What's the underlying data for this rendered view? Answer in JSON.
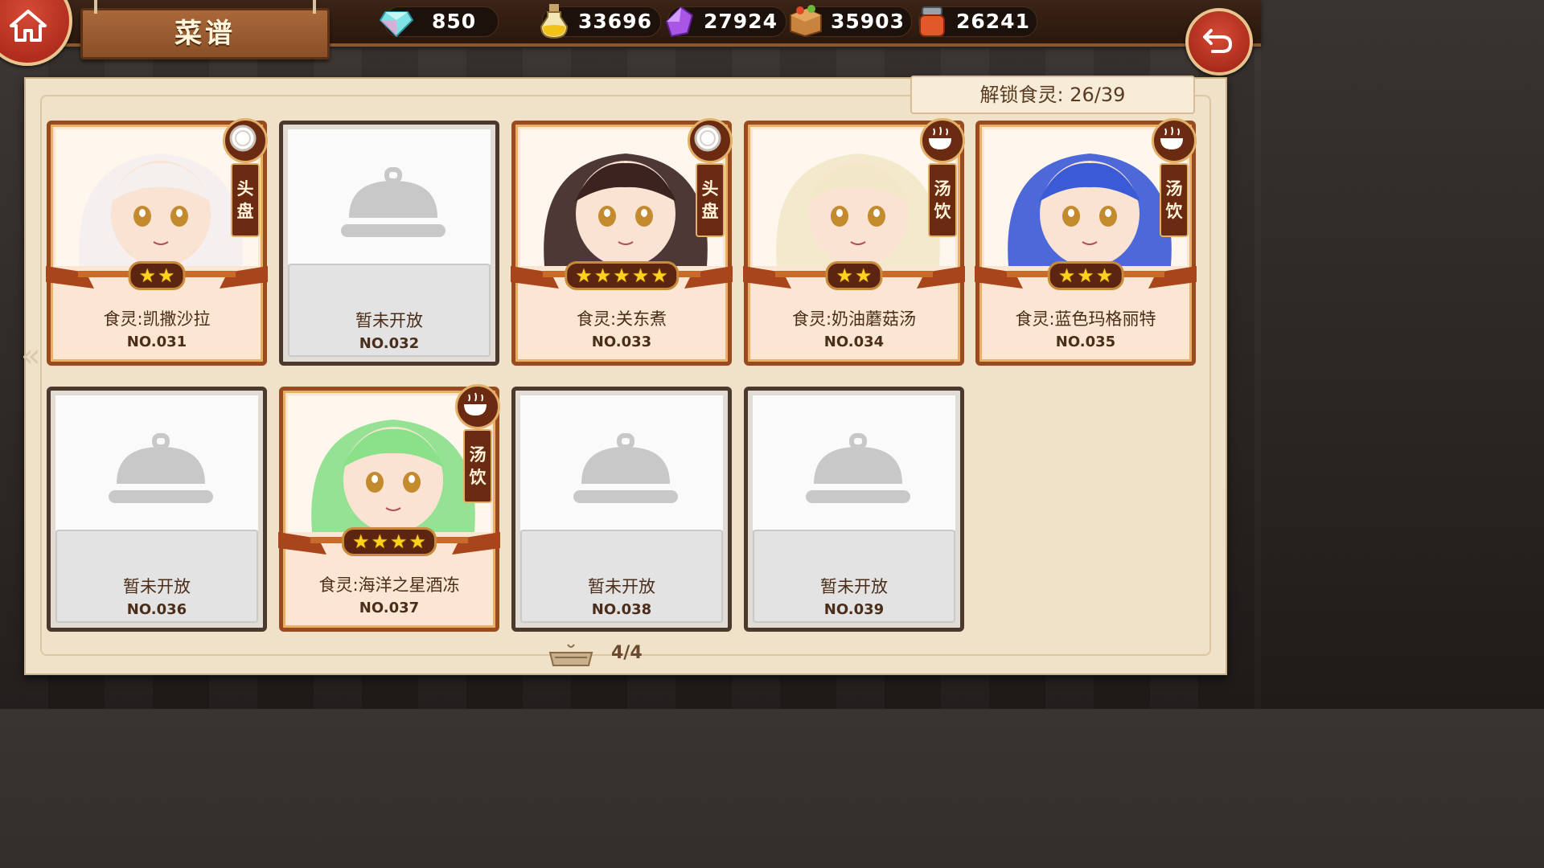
{
  "header": {
    "title": "菜谱",
    "resources": [
      {
        "icon": "diamond-icon",
        "value": "850"
      },
      {
        "icon": "potion-icon",
        "value": "33696"
      },
      {
        "icon": "purple-crystal-icon",
        "value": "27924"
      },
      {
        "icon": "ingredient-crate-icon",
        "value": "35903"
      },
      {
        "icon": "seasoning-jar-icon",
        "value": "26241"
      }
    ]
  },
  "unlock_label": "解锁食灵: 26/39",
  "pager": "4/4",
  "cards": [
    {
      "name": "食灵:凯撒沙拉",
      "number": "NO.031",
      "locked": false,
      "stars": 2,
      "type_line1": "头",
      "type_line2": "盘",
      "type_icon": "plate-icon"
    },
    {
      "name": "暂未开放",
      "number": "NO.032",
      "locked": true
    },
    {
      "name": "食灵:关东煮",
      "number": "NO.033",
      "locked": false,
      "stars": 5,
      "type_line1": "头",
      "type_line2": "盘",
      "type_icon": "plate-icon"
    },
    {
      "name": "食灵:奶油蘑菇汤",
      "number": "NO.034",
      "locked": false,
      "stars": 2,
      "type_line1": "汤",
      "type_line2": "饮",
      "type_icon": "soup-bowl-icon"
    },
    {
      "name": "食灵:蓝色玛格丽特",
      "number": "NO.035",
      "locked": false,
      "stars": 3,
      "type_line1": "汤",
      "type_line2": "饮",
      "type_icon": "soup-bowl-icon"
    },
    {
      "name": "暂未开放",
      "number": "NO.036",
      "locked": true
    },
    {
      "name": "食灵:海洋之星酒冻",
      "number": "NO.037",
      "locked": false,
      "stars": 4,
      "type_line1": "汤",
      "type_line2": "饮",
      "type_icon": "soup-bowl-icon"
    },
    {
      "name": "暂未开放",
      "number": "NO.038",
      "locked": true
    },
    {
      "name": "暂未开放",
      "number": "NO.039",
      "locked": true
    }
  ],
  "colors": {
    "accent_red": "#c23a26",
    "frame_brown": "#9a4a1f",
    "star_yellow": "#ffd21e"
  }
}
